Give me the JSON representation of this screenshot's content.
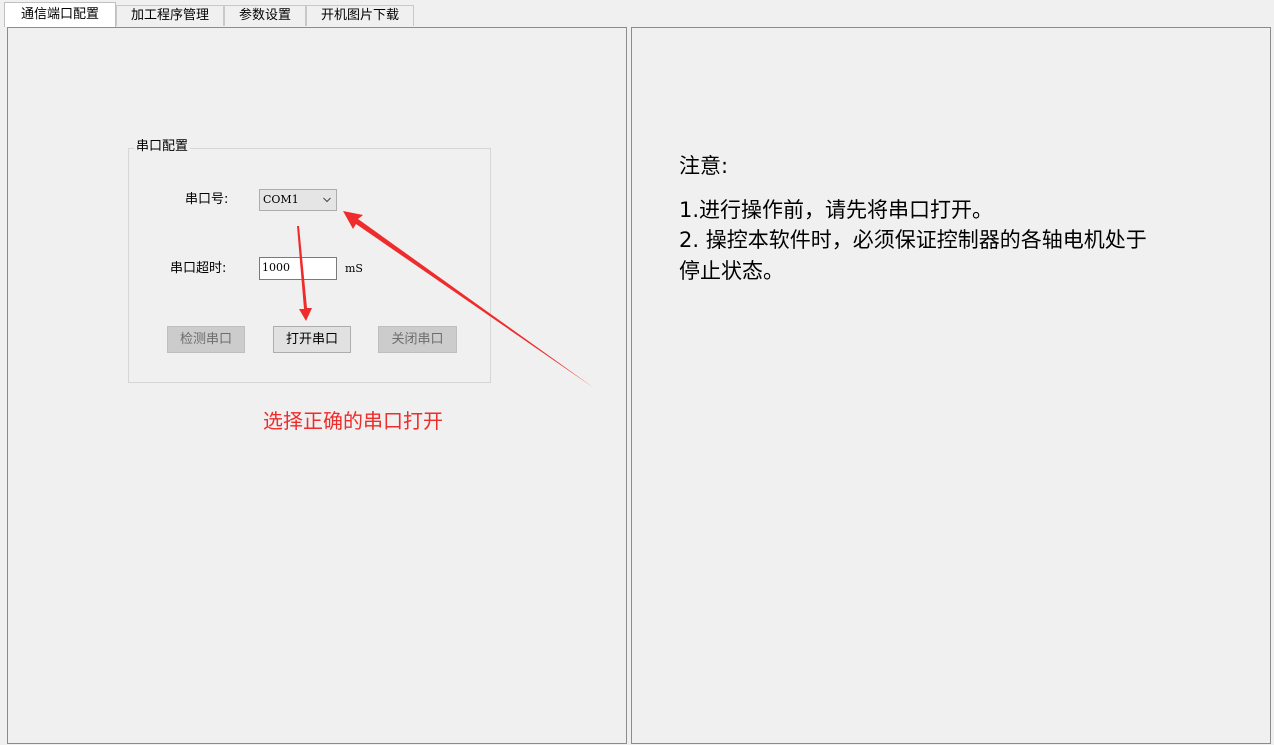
{
  "tabs": [
    {
      "label": "通信端口配置",
      "active": true
    },
    {
      "label": "加工程序管理",
      "active": false
    },
    {
      "label": "参数设置",
      "active": false
    },
    {
      "label": "开机图片下载",
      "active": false
    }
  ],
  "serial_config": {
    "group_title": "串口配置",
    "port_label": "串口号:",
    "port_value": "COM1",
    "timeout_label": "串口超时:",
    "timeout_value": "1000",
    "timeout_unit": "mS",
    "detect_button": "检测串口",
    "open_button": "打开串口",
    "close_button": "关闭串口"
  },
  "annotation": {
    "text": "选择正确的串口打开",
    "color": "#ef2c2c"
  },
  "notice": {
    "title": "注意:",
    "lines": [
      "1.进行操作前，请先将串口打开。",
      "2. 操控本软件时，必须保证控制器的各轴电机处于",
      "停止状态。"
    ]
  },
  "icons": {
    "combo_dropdown": "chevron-down-icon",
    "annotation_arrows": "red-arrow-icon"
  }
}
